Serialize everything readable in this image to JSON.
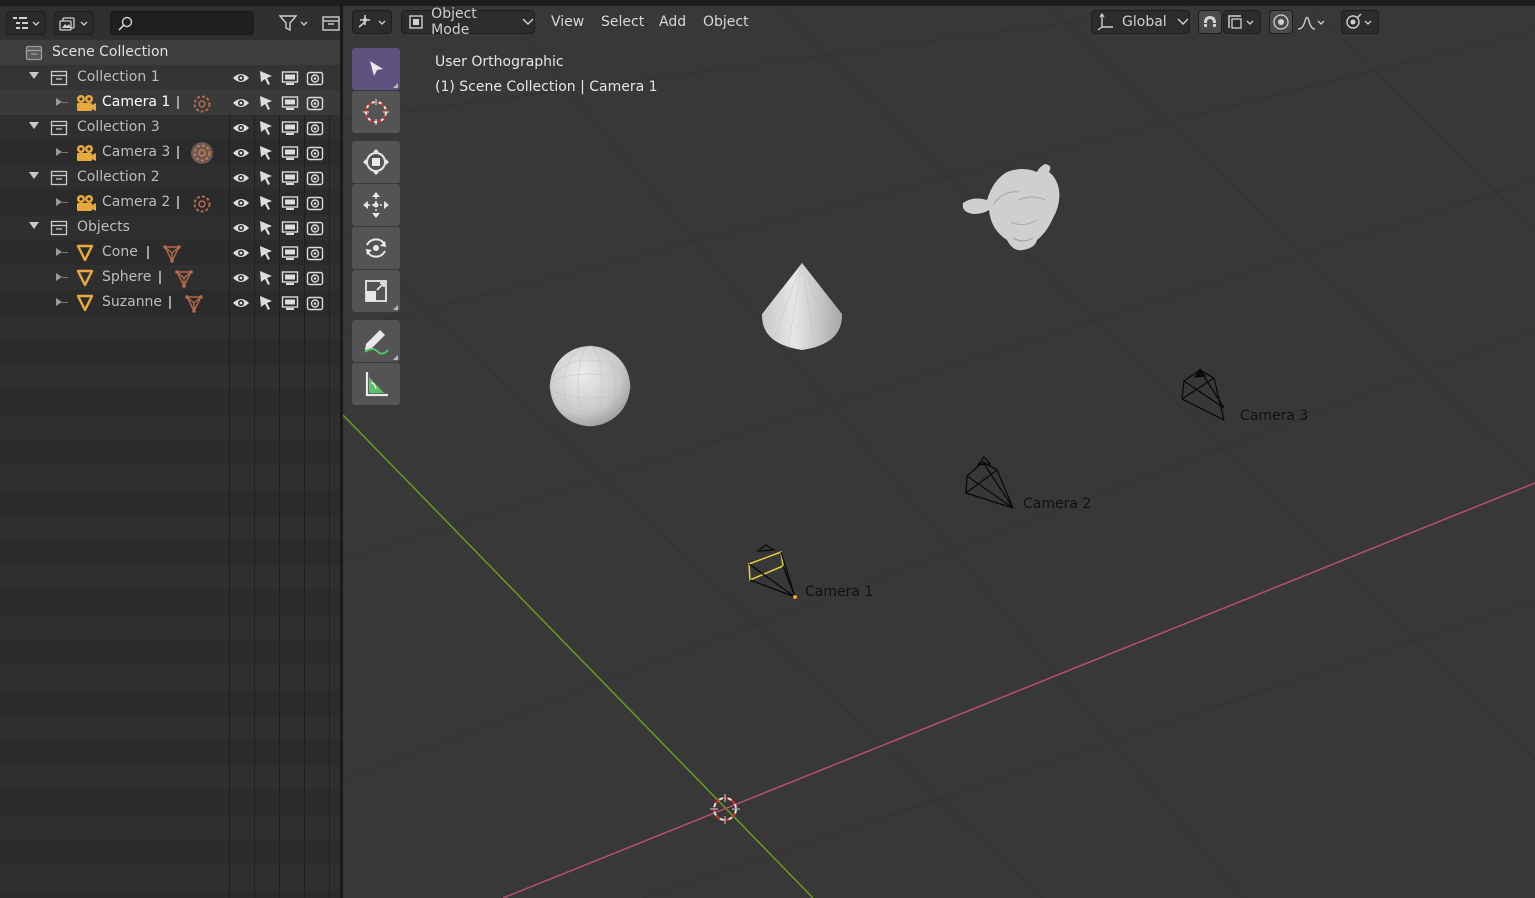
{
  "outliner": {
    "search": {
      "placeholder": ""
    },
    "scene_collection": "Scene Collection",
    "rows": [
      {
        "label": "Collection 1",
        "kind": "collection",
        "depth": 1,
        "expanded": true
      },
      {
        "label": "Camera 1",
        "kind": "camera",
        "depth": 2,
        "active": true
      },
      {
        "label": "Collection 3",
        "kind": "collection",
        "depth": 1,
        "expanded": true
      },
      {
        "label": "Camera 3",
        "kind": "camera",
        "depth": 2
      },
      {
        "label": "Collection 2",
        "kind": "collection",
        "depth": 1,
        "expanded": true
      },
      {
        "label": "Camera 2",
        "kind": "camera",
        "depth": 2
      },
      {
        "label": "Objects",
        "kind": "collection",
        "depth": 1,
        "expanded": true
      },
      {
        "label": "Cone",
        "kind": "mesh",
        "depth": 2
      },
      {
        "label": "Sphere",
        "kind": "mesh",
        "depth": 2
      },
      {
        "label": "Suzanne",
        "kind": "mesh",
        "depth": 2
      }
    ]
  },
  "viewport": {
    "mode": "Object Mode",
    "menus": [
      "View",
      "Select",
      "Add",
      "Object"
    ],
    "orientation": "Global",
    "view_name": "User Orthographic",
    "context": "(1) Scene Collection | Camera 1",
    "camera_labels": [
      "Camera 1",
      "Camera 2",
      "Camera 3"
    ]
  },
  "colors": {
    "x_axis": "#b5506e",
    "y_axis": "#6a9a1e",
    "selected_camera": "#e3d23a",
    "camera_icon": "#e8a93c",
    "mesh_icon": "#e8a93c",
    "active_tool": "#5f5180"
  }
}
